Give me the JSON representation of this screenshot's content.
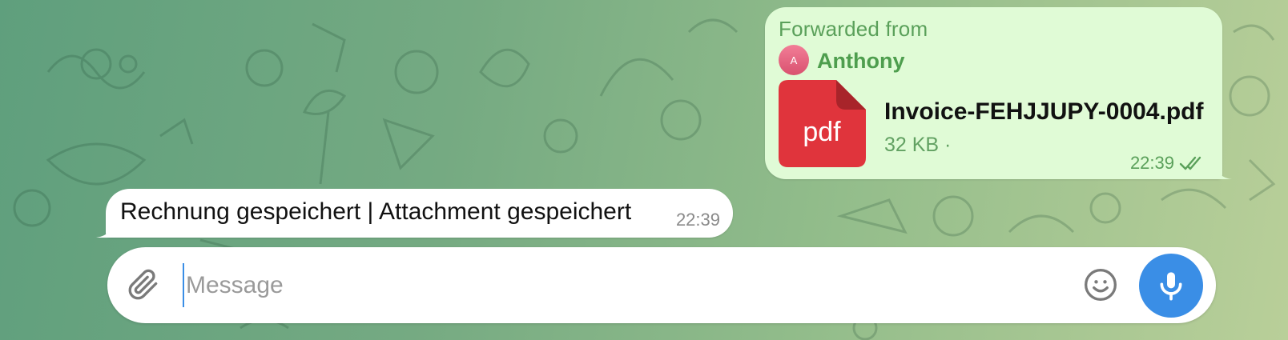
{
  "forwarded_message": {
    "forwarded_label": "Forwarded from",
    "author_initial": "A",
    "author_name": "Anthony",
    "file": {
      "icon": "pdf-file-icon",
      "type_label": "pdf",
      "name": "Invoice-FEHJJUPY-0004.pdf",
      "size": "32 KB ·"
    },
    "time": "22:39",
    "status_icon": "double-check-icon"
  },
  "incoming_message": {
    "text": "Rechnung gespeichert | Attachment gespeichert",
    "time": "22:39"
  },
  "composer": {
    "attach_icon": "paperclip-icon",
    "placeholder": "Message",
    "emoji_icon": "smiley-icon",
    "mic_icon": "microphone-icon"
  },
  "colors": {
    "outgoing_bubble": "#e0fbd6",
    "incoming_bubble": "#ffffff",
    "accent_green": "#5aa05a",
    "pdf_red": "#e0343c",
    "mic_blue": "#3a8ee6",
    "avatar_pink": "#e8667f"
  }
}
